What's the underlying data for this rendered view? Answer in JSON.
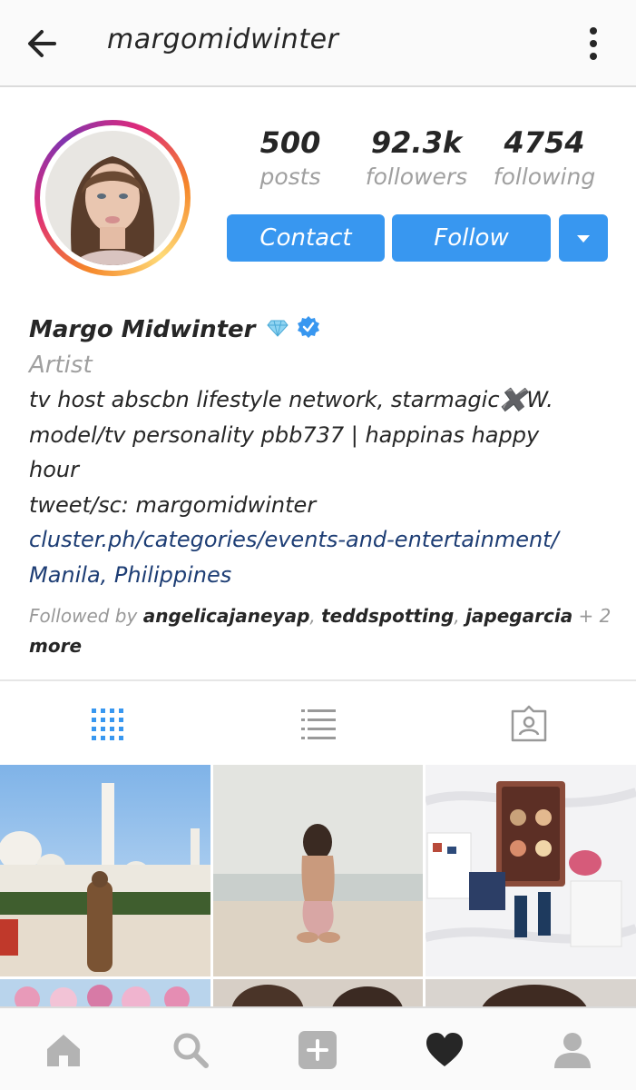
{
  "header": {
    "username": "margomidwinter",
    "back_icon": "arrow-left-icon",
    "menu_icon": "more-vertical-icon"
  },
  "profile": {
    "stats": [
      {
        "value": "500",
        "label": "posts"
      },
      {
        "value": "92.3k",
        "label": "followers"
      },
      {
        "value": "4754",
        "label": "following"
      }
    ],
    "buttons": {
      "contact": "Contact",
      "follow": "Follow",
      "dropdown_icon": "caret-down-icon"
    },
    "name": "Margo Midwinter",
    "category": "Artist",
    "bio_lines": [
      "tv host abscbn lifestyle network, starmagic✖️W.",
      "model/tv personality pbb737 | happinas happy",
      "hour",
      "tweet/sc: margomidwinter"
    ],
    "website": "cluster.ph/categories/events-and-entertainment/",
    "location": "Manila, Philippines",
    "followed_by": {
      "prefix": "Followed by ",
      "users": [
        "angelicajaneyap",
        "teddspotting",
        "japegarcia"
      ],
      "sep": ", ",
      "suffix": " + 2",
      "more": "more"
    }
  },
  "colors": {
    "accent": "#3897f0",
    "link": "#1d3d74",
    "muted": "#a0a0a0"
  }
}
